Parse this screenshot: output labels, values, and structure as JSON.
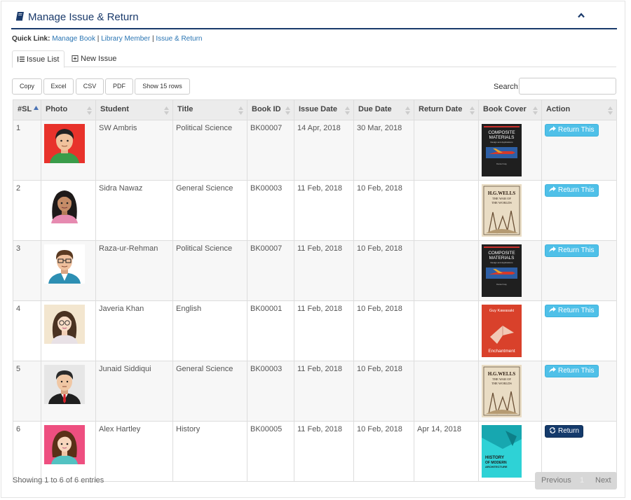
{
  "header": {
    "title": "Manage Issue & Return",
    "icon": "book-icon",
    "toggle_icon": "chevron-up-icon"
  },
  "quick_links": {
    "label": "Quick Link:",
    "links": [
      "Manage Book",
      "Library Member",
      "Issue & Return"
    ],
    "separator": "|"
  },
  "tabs": [
    {
      "label": "Issue List",
      "icon": "list-icon",
      "active": true
    },
    {
      "label": "New Issue",
      "icon": "plus-square-icon",
      "active": false
    }
  ],
  "toolbar": {
    "buttons": [
      "Copy",
      "Excel",
      "CSV",
      "PDF",
      "Show 15 rows"
    ],
    "search_label": "Search:",
    "search_value": ""
  },
  "table": {
    "columns": [
      "#SL",
      "Photo",
      "Student",
      "Title",
      "Book ID",
      "Issue Date",
      "Due Date",
      "Return Date",
      "Book Cover",
      "Action"
    ],
    "sorted_column": "#SL",
    "rows": [
      {
        "sl": "1",
        "student": "SW Ambris",
        "title": "Political Science",
        "book_id": "BK00007",
        "issue_date": "14 Apr, 2018",
        "due_date": "30 Mar, 2018",
        "return_date": "",
        "action": "Return This",
        "photo": "avatar-man-red",
        "cover": "composite-materials"
      },
      {
        "sl": "2",
        "student": "Sidra Nawaz",
        "title": "General Science",
        "book_id": "BK00003",
        "issue_date": "11 Feb, 2018",
        "due_date": "10 Feb, 2018",
        "return_date": "",
        "action": "Return This",
        "photo": "avatar-woman-dark",
        "cover": "war-of-the-worlds"
      },
      {
        "sl": "3",
        "student": "Raza-ur-Rehman",
        "title": "Political Science",
        "book_id": "BK00007",
        "issue_date": "11 Feb, 2018",
        "due_date": "10 Feb, 2018",
        "return_date": "",
        "action": "Return This",
        "photo": "avatar-man-glasses",
        "cover": "composite-materials"
      },
      {
        "sl": "4",
        "student": "Javeria Khan",
        "title": "English",
        "book_id": "BK00001",
        "issue_date": "11 Feb, 2018",
        "due_date": "10 Feb, 2018",
        "return_date": "",
        "action": "Return This",
        "photo": "avatar-woman-glasses",
        "cover": "enchantment"
      },
      {
        "sl": "5",
        "student": "Junaid Siddiqui",
        "title": "General Science",
        "book_id": "BK00003",
        "issue_date": "11 Feb, 2018",
        "due_date": "10 Feb, 2018",
        "return_date": "",
        "action": "Return This",
        "photo": "avatar-man-suit",
        "cover": "war-of-the-worlds"
      },
      {
        "sl": "6",
        "student": "Alex Hartley",
        "title": "History",
        "book_id": "BK00005",
        "issue_date": "11 Feb, 2018",
        "due_date": "10 Feb, 2018",
        "return_date": "Apr 14, 2018",
        "action": "Return",
        "photo": "avatar-woman-pink",
        "cover": "history-modern-architecture"
      }
    ]
  },
  "covers": {
    "composite-materials": {
      "line1": "COMPOSITE",
      "line2": "MATERIALS",
      "line3": "Design and Applications",
      "line4": "Daniel Gay"
    },
    "war-of-the-worlds": {
      "line1": "H.G.WELLS",
      "line2": "THE WAR OF",
      "line3": "THE WORLDS"
    },
    "enchantment": {
      "line1": "Guy Kawasaki",
      "line2": "Enchantment"
    },
    "history-modern-architecture": {
      "line1": "HISTORY",
      "line2": "OF MODERN",
      "line3": "ARCHITECTURE"
    }
  },
  "footer": {
    "info": "Showing 1 to 6 of 6 entries"
  },
  "pagination": {
    "previous": "Previous",
    "page": "1",
    "next": "Next"
  },
  "colors": {
    "primary": "#1a3a6b",
    "link": "#2a75b3",
    "return_btn": "#4fc0e8",
    "return_dark": "#143a6b"
  }
}
